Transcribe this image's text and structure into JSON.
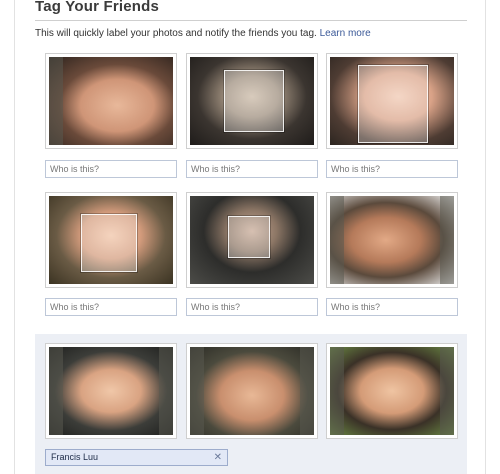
{
  "header": {
    "title": "Tag Your Friends",
    "subtitle": "This will quickly label your photos and notify the friends you tag.",
    "learn_more": "Learn more"
  },
  "suggestions": [
    {
      "face": "person-1-face-photo",
      "placeholder": "Who is this?"
    },
    {
      "face": "person-2-face-photo",
      "placeholder": "Who is this?"
    },
    {
      "face": "person-3-face-photo",
      "placeholder": "Who is this?"
    },
    {
      "face": "person-4-face-photo",
      "placeholder": "Who is this?"
    },
    {
      "face": "person-5-face-photo",
      "placeholder": "Who is this?"
    },
    {
      "face": "person-6-face-photo",
      "placeholder": "Who is this?"
    }
  ],
  "tagged_group": {
    "name": "Francis Luu",
    "remove_icon": "close-icon",
    "remove_glyph": "✕"
  }
}
